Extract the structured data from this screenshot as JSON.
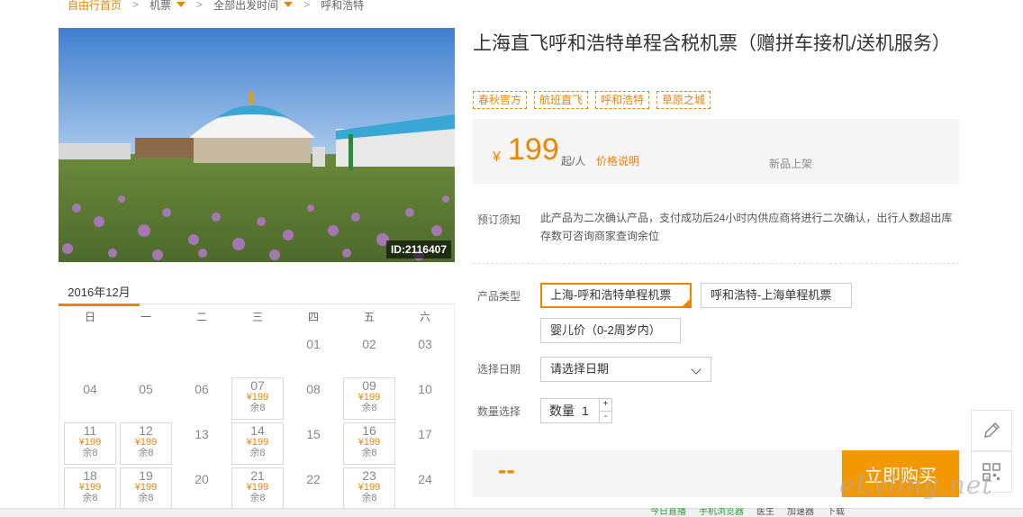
{
  "breadcrumb": {
    "items": [
      "自由行首页",
      "机票",
      "全部出发时间",
      "呼和浩特"
    ]
  },
  "hero": {
    "image_id": "ID:2116407"
  },
  "product": {
    "title": "上海直飞呼和浩特单程含税机票（赠拼车接机/送机服务）",
    "tags": [
      "春秋官方",
      "航班直飞",
      "呼和浩特",
      "草原之城"
    ],
    "price": {
      "currency": "¥",
      "amount": "199",
      "unit": "起/人",
      "note": "价格说明",
      "status": "新品上架"
    },
    "notice": {
      "label": "预订须知",
      "text": "此产品为二次确认产品，支付成功后24小时内供应商将进行二次确认，出行人数超出库存数可咨询商家查询余位"
    },
    "type": {
      "label": "产品类型",
      "options": [
        "上海-呼和浩特单程机票",
        "呼和浩特-上海单程机票",
        "婴儿价（0-2周岁内）"
      ]
    },
    "date": {
      "label": "选择日期",
      "value": "请选择日期"
    },
    "quantity": {
      "label": "数量选择",
      "prefix": "数量",
      "value": "1",
      "plus": "+",
      "minus": "-"
    },
    "total": "--",
    "buy_label": "立即购买"
  },
  "calendar": {
    "month": "2016年12月",
    "weekdays": [
      "日",
      "一",
      "二",
      "三",
      "四",
      "五",
      "六"
    ],
    "days": [
      {
        "num": "",
        "price": "",
        "stock": ""
      },
      {
        "num": "",
        "price": "",
        "stock": ""
      },
      {
        "num": "",
        "price": "",
        "stock": ""
      },
      {
        "num": "",
        "price": "",
        "stock": ""
      },
      {
        "num": "01",
        "price": "",
        "stock": ""
      },
      {
        "num": "02",
        "price": "",
        "stock": ""
      },
      {
        "num": "03",
        "price": "",
        "stock": ""
      },
      {
        "num": "04",
        "price": "",
        "stock": ""
      },
      {
        "num": "05",
        "price": "",
        "stock": ""
      },
      {
        "num": "06",
        "price": "",
        "stock": ""
      },
      {
        "num": "07",
        "price": "¥199",
        "stock": "余8"
      },
      {
        "num": "08",
        "price": "",
        "stock": ""
      },
      {
        "num": "09",
        "price": "¥199",
        "stock": "余8"
      },
      {
        "num": "10",
        "price": "",
        "stock": ""
      },
      {
        "num": "11",
        "price": "¥199",
        "stock": "余8"
      },
      {
        "num": "12",
        "price": "¥199",
        "stock": "余8"
      },
      {
        "num": "13",
        "price": "",
        "stock": ""
      },
      {
        "num": "14",
        "price": "¥199",
        "stock": "余8"
      },
      {
        "num": "15",
        "price": "",
        "stock": ""
      },
      {
        "num": "16",
        "price": "¥199",
        "stock": "余8"
      },
      {
        "num": "17",
        "price": "",
        "stock": ""
      },
      {
        "num": "18",
        "price": "¥199",
        "stock": "余8"
      },
      {
        "num": "19",
        "price": "¥199",
        "stock": "余8"
      },
      {
        "num": "20",
        "price": "",
        "stock": ""
      },
      {
        "num": "21",
        "price": "¥199",
        "stock": "余8"
      },
      {
        "num": "22",
        "price": "",
        "stock": ""
      },
      {
        "num": "23",
        "price": "¥199",
        "stock": "余8"
      },
      {
        "num": "24",
        "price": "",
        "stock": ""
      }
    ]
  },
  "status_bar": {
    "items": [
      "今日直播",
      "手机浏览器",
      "医生",
      "加速器",
      "下载"
    ]
  },
  "watermark": "eLvling.net",
  "colors": {
    "accent": "#f08300",
    "buy_button": "#f39800"
  }
}
